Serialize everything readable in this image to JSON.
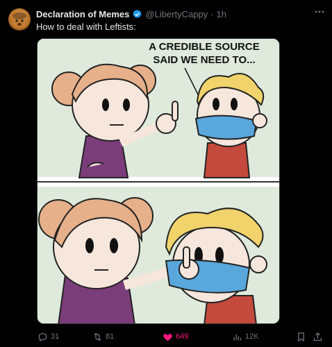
{
  "tweet": {
    "author_name": "Declaration of Memes",
    "handle": "@LibertyCappy",
    "separator": "·",
    "time": "1h",
    "text": "How to deal with Leftists:"
  },
  "meme": {
    "caption_line1": "A CREDIBLE SOURCE",
    "caption_line2": "SAID WE NEED TO..."
  },
  "actions": {
    "replies": "31",
    "reposts": "81",
    "likes": "649",
    "views": "12K"
  },
  "colors": {
    "background": "#000000",
    "text": "#e7e9ea",
    "muted": "#71767b",
    "verified": "#1d9bf0",
    "like": "#f91880"
  },
  "icons": [
    "more-icon",
    "verified-icon",
    "reply-icon",
    "repost-icon",
    "like-icon",
    "views-icon",
    "bookmark-icon",
    "share-icon"
  ]
}
